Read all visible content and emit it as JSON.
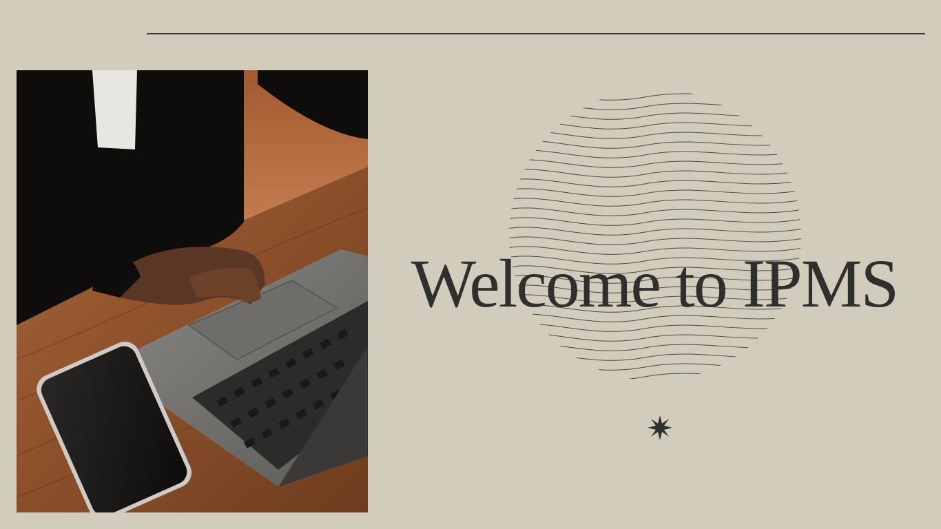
{
  "slide": {
    "title": "Welcome to IPMS",
    "background_color": "#d1ccbb",
    "text_color": "#2f2f2d",
    "photo": {
      "icon": "laptop-photo"
    },
    "decorations": {
      "wave_circle": "wave-circle-icon",
      "star": "star-icon",
      "rule": "horizontal-rule"
    }
  }
}
